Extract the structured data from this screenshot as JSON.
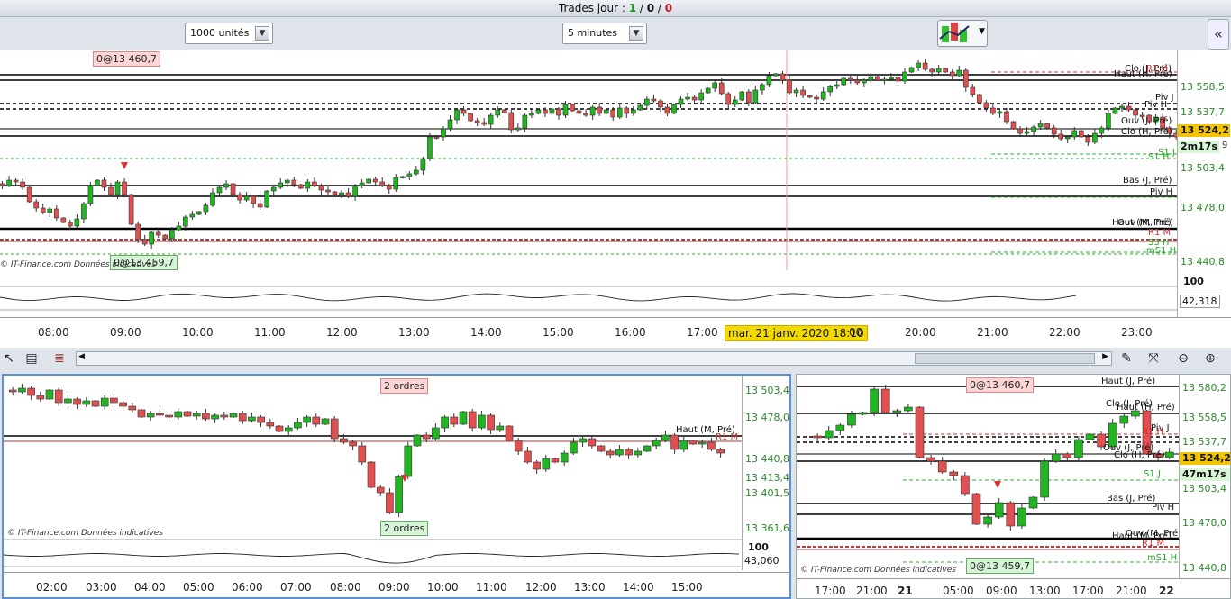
{
  "trades": {
    "label": "Trades jour :",
    "a": "1",
    "b": "0",
    "c": "0",
    "sep": " / "
  },
  "toolbar": {
    "qty": "1000 unités",
    "interval": "5 minutes"
  },
  "main": {
    "badge_top": "0@13 460,7",
    "badge_bottom": "0@13 459,7",
    "watermark": "© IT-Finance.com  Données indicatives",
    "crosshair_label": "mar. 21 janv. 2020 18:10",
    "timer": "2m17s",
    "osc_max": "100",
    "osc_val": "42,318",
    "osc_side": "9",
    "price_labels": [
      "13 558,5",
      "13 537,7",
      "13 524,2",
      "13 503,4",
      "13 478,0",
      "13 440,8"
    ],
    "level_labels": [
      "Clo (J, Pré)",
      "Haut (H, Pré)",
      "R1 H",
      "Piv J",
      "Piv H",
      "Ouv (J, Pré)",
      "Clo (H, Pré)",
      "S1 J",
      "S1 H",
      "Bas (J, Pré)",
      "Piv H",
      "Haut (M, Pré)",
      "Ouv (M, Pré)",
      "R1 M",
      "S3 H",
      "mS1 H"
    ],
    "times": [
      "08:00",
      "09:00",
      "10:00",
      "11:00",
      "12:00",
      "13:00",
      "14:00",
      "15:00",
      "16:00",
      "17:00",
      "20:00",
      "21:00",
      "22:00",
      "23:00"
    ],
    "hidden_time": "00"
  },
  "left": {
    "badge_top": "2 ordres",
    "badge_bottom": "2 ordres",
    "watermark": "© IT-Finance.com  Données indicatives",
    "level_label": "Haut (M, Pré)",
    "level_label2": "R1 M",
    "price_labels": [
      "13 503,4",
      "13 478,0",
      "13 440,8",
      "13 413,4",
      "13 401,5",
      "13 361,6"
    ],
    "osc_max": "100",
    "osc_val": "43,060",
    "times": [
      "02:00",
      "03:00",
      "04:00",
      "05:00",
      "06:00",
      "07:00",
      "08:00",
      "09:00",
      "10:00",
      "11:00",
      "12:00",
      "13:00",
      "14:00",
      "15:00"
    ]
  },
  "right": {
    "badge_top": "0@13 460,7",
    "badge_bottom": "0@13 459,7",
    "watermark": "© IT-Finance.com  Données indicatives",
    "timer": "47m17s",
    "price_labels": [
      "13 580,2",
      "13 558,5",
      "13 537,7",
      "13 524,2",
      "13 503,4",
      "13 478,0",
      "13 440,8"
    ],
    "level_labels": [
      "Haut (J, Pré)",
      "Clo (J, Pré)",
      "Haut (H, Pré)",
      "Piv J",
      "R1 H",
      "Ouv (J, Pré)",
      "Clo (H, Pré)",
      "S1 J",
      "Bas (J, Pré)",
      "Piv H",
      "Ouv (M, Pré)",
      "Haut (M, Pré)",
      "R1 M",
      "mS1 H"
    ],
    "times": [
      "17:00",
      "21:00",
      "21",
      "05:00",
      "09:00",
      "13:00",
      "17:00",
      "21:00",
      "22"
    ]
  },
  "colors": {
    "up": "#22b522",
    "down": "#e05050",
    "current": "#f3c400"
  }
}
